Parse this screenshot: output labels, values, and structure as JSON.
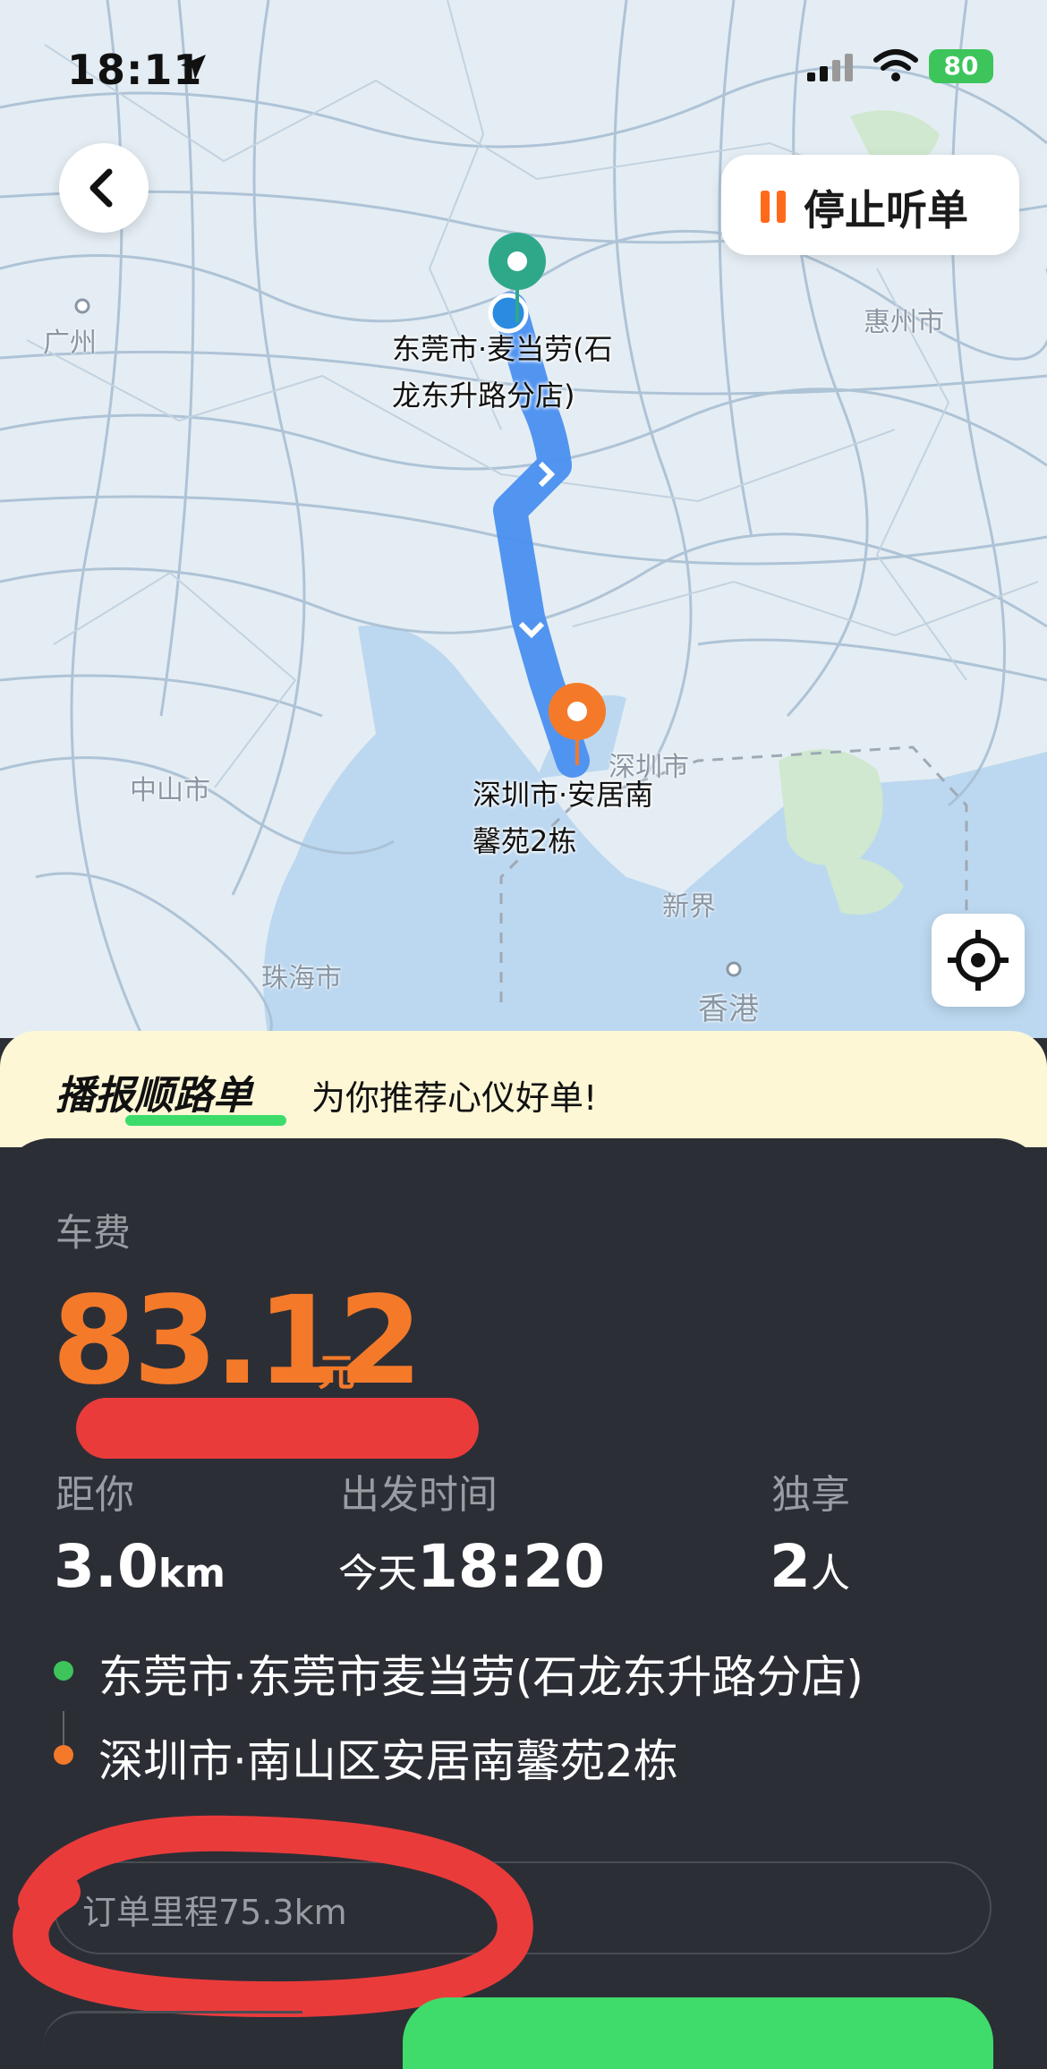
{
  "status_bar": {
    "time": "18:11",
    "battery": "80",
    "icons": [
      "location-arrow-icon",
      "signal-icon",
      "wifi-icon",
      "battery-icon"
    ]
  },
  "map": {
    "stop_button_label": "停止听单",
    "pickup_label_line1": "东莞市·麦当劳(石",
    "pickup_label_line2": "龙东升路分店)",
    "dropoff_label_line1": "深圳市·安居南",
    "dropoff_label_line2": "馨苑2栋",
    "cities": {
      "guangzhou": "广州",
      "huizhou": "惠州市",
      "zhongshan": "中山市",
      "shenzhen": "深圳市",
      "zhuhai": "珠海市",
      "xinjie": "新界",
      "hongkong": "香港"
    },
    "colors": {
      "route": "#4a90f0",
      "pickup": "#2fa88a",
      "dropoff": "#f47a2a"
    }
  },
  "banner": {
    "brand": "播报顺路单",
    "slogan": "为你推荐心仪好单!"
  },
  "order": {
    "fare_label": "车费",
    "fare_value": "83.12",
    "fare_unit": "元",
    "distance_label": "距你",
    "distance_value": "3.0",
    "distance_unit": "km",
    "time_label": "出发时间",
    "time_prefix": "今天",
    "time_value": "18:20",
    "type_label": "独享",
    "passengers_value": "2",
    "passengers_unit": "人",
    "from": "东莞市·东莞市麦当劳(石龙东升路分店)",
    "to": "深圳市·南山区安居南馨苑2栋",
    "mileage": "订单里程75.3km"
  },
  "colors": {
    "accent": "#f47a2a",
    "green": "#3dc55c",
    "card_bg": "#2c2e36",
    "banner_bg": "#fdf7d6"
  }
}
